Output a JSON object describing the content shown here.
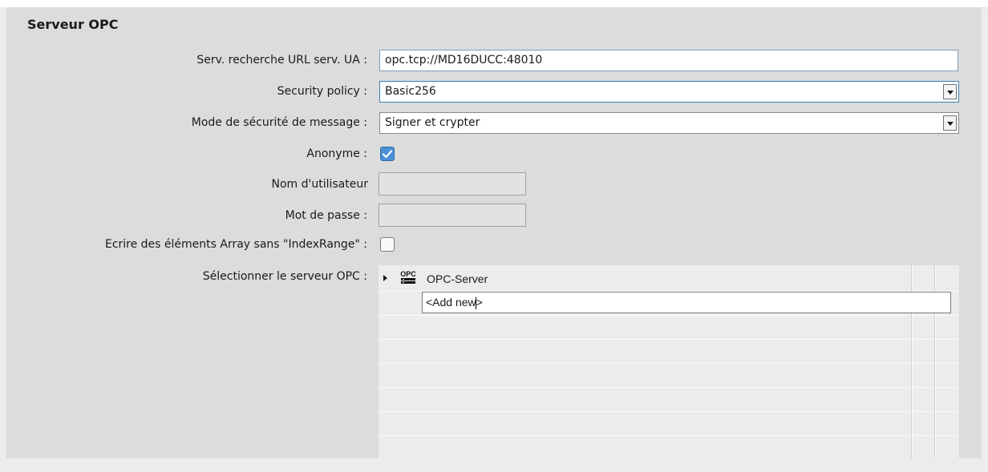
{
  "section": {
    "title": "Serveur OPC"
  },
  "fields": {
    "url": {
      "label": "Serv. recherche URL serv. UA :",
      "value": "opc.tcp://MD16DUCC:48010"
    },
    "security_policy": {
      "label": "Security policy :",
      "value": "Basic256"
    },
    "message_security_mode": {
      "label": "Mode de sécurité de message :",
      "value": "Signer et crypter"
    },
    "anonymous": {
      "label": "Anonyme :",
      "checked": true
    },
    "username": {
      "label": "Nom d'utilisateur",
      "value": ""
    },
    "password": {
      "label": "Mot de passe :",
      "value": ""
    },
    "write_array": {
      "label": "Ecrire des éléments Array sans \"IndexRange\" :",
      "checked": false
    },
    "select_server": {
      "label": "Sélectionner le serveur OPC :"
    }
  },
  "tree": {
    "items": [
      {
        "label": "OPC-Server",
        "icon": "opc-server-icon",
        "expanded": false
      }
    ],
    "add_new": "<Add new>"
  },
  "colors": {
    "panel": "#dcdcdc",
    "checkbox_checked": "#4a90d9",
    "focus_border": "#3c7fb1"
  }
}
